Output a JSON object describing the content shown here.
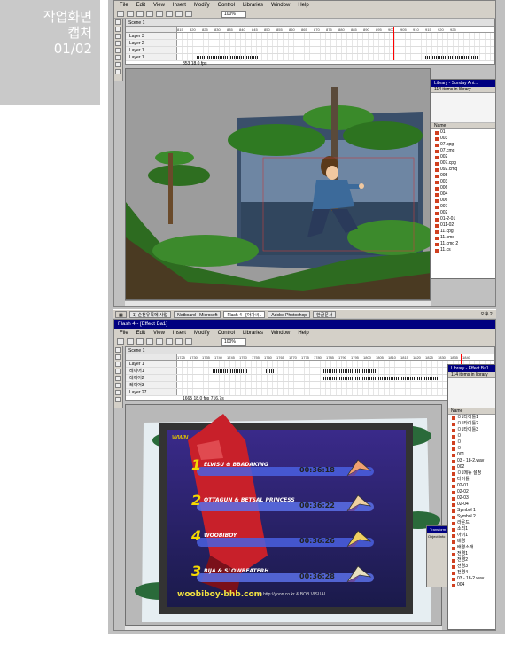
{
  "label": {
    "line1": "작업화면",
    "line2": "캡처",
    "line3": "01/02"
  },
  "win1": {
    "menu": [
      "File",
      "Edit",
      "View",
      "Insert",
      "Modify",
      "Control",
      "Libraries",
      "Window",
      "Help"
    ],
    "zoom": "100%",
    "scene": "Scene 1",
    "layers": [
      "Layer 3",
      "Layer 2",
      "Layer 1",
      "Layer 1"
    ],
    "frame_numbers": [
      "815",
      "820",
      "825",
      "830",
      "835",
      "840",
      "845",
      "850",
      "855",
      "860",
      "865",
      "870",
      "875",
      "880",
      "885",
      "890",
      "895",
      "900",
      "905",
      "910",
      "915",
      "920",
      "925"
    ],
    "status": "853   18.0 fps",
    "library_title": "Library - Sunday Ani...",
    "library_sub": "114 items in library",
    "library_header": "Name",
    "library_items": [
      "01",
      "003",
      "07.cpg",
      "07.cmq",
      "002",
      "007.cpg",
      "092.cmq",
      "005",
      "003",
      "006",
      "004",
      "006",
      "007",
      "002",
      "01-2-01",
      "011-02",
      "11.cpg",
      "11.cmq",
      "11.cmq 2",
      "11.cs"
    ]
  },
  "taskbar": {
    "items": [
      "1) 순천유목에 사업",
      "Netboard - Microsoft",
      "Flash 4 - [아가씨..",
      "Adobe Photoshop",
      "한글문서"
    ],
    "clock": "오후 2:"
  },
  "win2": {
    "title": "Flash 4 - [Effect Ba1]",
    "menu": [
      "File",
      "Edit",
      "View",
      "Insert",
      "Modify",
      "Control",
      "Libraries",
      "Window",
      "Help"
    ],
    "zoom": "100%",
    "scene": "Scene 1",
    "layers": [
      "Layer 1",
      "레이어1",
      "레이어2",
      "레이어3",
      "Layer 27"
    ],
    "frame_numbers": [
      "1725",
      "1730",
      "1735",
      "1740",
      "1745",
      "1750",
      "1755",
      "1760",
      "1765",
      "1770",
      "1775",
      "1780",
      "1785",
      "1790",
      "1795",
      "1800",
      "1805",
      "1810",
      "1815",
      "1820",
      "1825",
      "1830",
      "1835",
      "1840"
    ],
    "status": "1665   18.0 fps   716.7s",
    "library_title": "Library - Effect Ba1",
    "library_sub": "114 items in library",
    "library_header": "Name",
    "library_items": [
      "ㅁ1타이틀1",
      "ㅁ1타이틀2",
      "ㅁ1타이틀3",
      "ㅁ",
      "ㅁ",
      "ㅁ",
      "001",
      "03 - 18-2.wav",
      "002",
      "ㅁ1메뉴 설정",
      "타이틀",
      "02-01",
      "02-02",
      "02-03",
      "02-04",
      "Symbol 1",
      "Symbol 2",
      "라운드",
      "소리1",
      "아이1",
      "배경",
      "배경소개",
      "전경1",
      "전경2",
      "전경3",
      "전경4",
      "03 - 18-2.wav",
      "004"
    ],
    "panel_title": "Transform",
    "panel_sub": "Object Info"
  },
  "ranking": {
    "tag": "WWN",
    "entries": [
      {
        "rank": "1",
        "name": "ELVISU & BBADAKING",
        "time": "00:36:18"
      },
      {
        "rank": "2",
        "name": "OTTAGUN & BETSAL PRINCESS",
        "time": "00:36:22"
      },
      {
        "rank": "4",
        "name": "WOOBIBOY",
        "time": "00:36:26"
      },
      {
        "rank": "3",
        "name": "BIJA & SLOWBEATERH",
        "time": "00:36:28"
      }
    ],
    "footer_url": "woobiboy-bhb.com",
    "footer_credit": "© http://yoon.co.kr & BOB VISUAL"
  },
  "colors": {
    "accent": "#000080",
    "label_bg": "#c9c9c9",
    "frame_bg": "#c0c0c0",
    "playhead": "#ff0000"
  }
}
